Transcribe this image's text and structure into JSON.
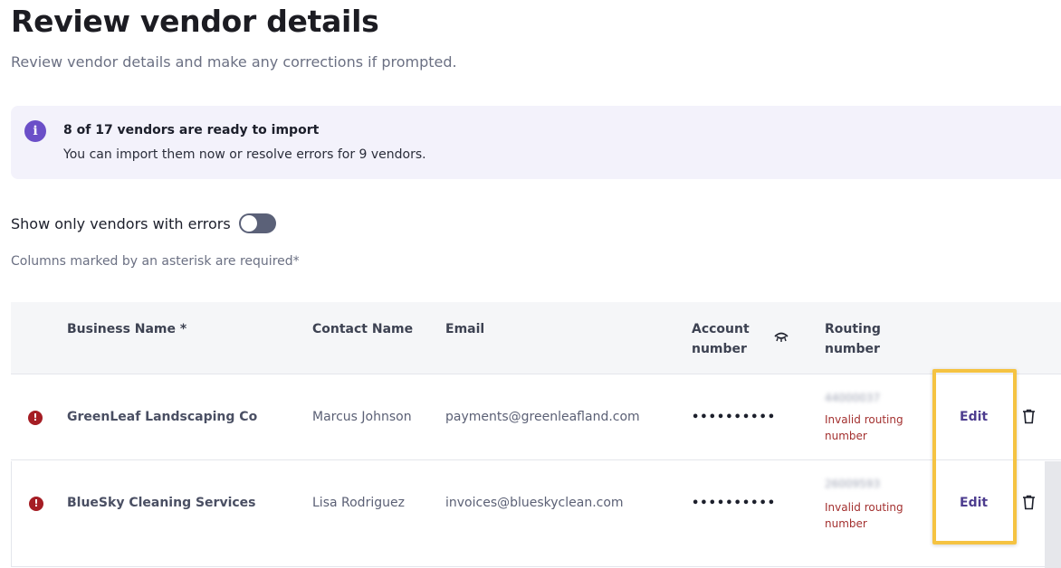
{
  "page": {
    "title": "Review vendor details",
    "subtitle": "Review vendor details and make any corrections if prompted."
  },
  "banner": {
    "icon": "info-icon",
    "title": "8 of 17 vendors are ready to import",
    "text": "You can import them now or resolve errors for 9 vendors."
  },
  "filter": {
    "label": "Show only vendors with errors",
    "toggle_on": false
  },
  "required_note": "Columns marked by an asterisk are required*",
  "table": {
    "columns": {
      "business_name": "Business Name *",
      "contact_name": "Contact Name",
      "email": "Email",
      "account_number_line1": "Account",
      "account_number_line2": "number",
      "routing_number_line1": "Routing",
      "routing_number_line2": "number"
    },
    "rows": [
      {
        "status_icon": "error-icon",
        "business_name": "GreenLeaf Landscaping Co",
        "contact_name": "Marcus Johnson",
        "email": "payments@greenleafland.com",
        "account_number": "••••••••••",
        "routing_number": "44000037",
        "routing_error_line1": "Invalid routing",
        "routing_error_line2": "number",
        "edit_label": "Edit"
      },
      {
        "status_icon": "error-icon",
        "business_name": "BlueSky Cleaning Services",
        "contact_name": "Lisa Rodriguez",
        "email": "invoices@blueskyclean.com",
        "account_number": "••••••••••",
        "routing_number": "26009593",
        "routing_error_line1": "Invalid routing",
        "routing_error_line2": "number",
        "edit_label": "Edit"
      }
    ]
  },
  "colors": {
    "accent": "#6b4fc8",
    "error": "#a51d24",
    "highlight": "#f5c342",
    "edit_link": "#4d3d8f"
  }
}
